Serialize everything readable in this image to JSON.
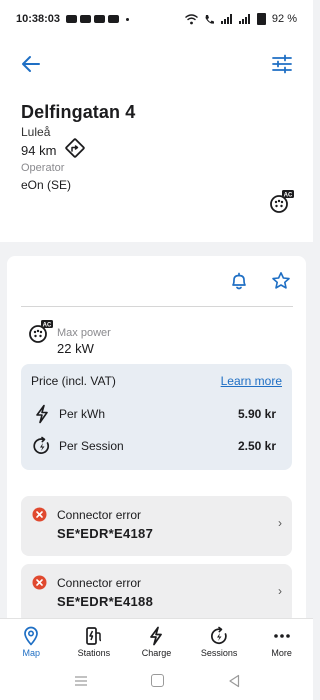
{
  "status_bar": {
    "time": "10:38:03",
    "battery": "92 %"
  },
  "icons": {
    "back": "arrow-left-icon",
    "filter": "sliders-icon",
    "route": "route-diamond-icon",
    "connector": "ac-type2-connector-icon",
    "bell": "bell-icon",
    "star": "star-icon",
    "lightning": "lightning-icon",
    "session": "session-timer-icon",
    "error": "error-x-icon"
  },
  "colors": {
    "accent": "#1f6fc4",
    "error": "#e0492f"
  },
  "station": {
    "name": "Delfingatan 4",
    "city": "Luleå",
    "distance": "94 km",
    "operator_label": "Operator",
    "operator": "eOn (SE)"
  },
  "power": {
    "label": "Max power",
    "value": "22 kW",
    "badge": "AC"
  },
  "price": {
    "title": "Price (incl. VAT)",
    "learn_more": "Learn more",
    "rows": [
      {
        "label": "Per kWh",
        "value": "5.90 kr"
      },
      {
        "label": "Per Session",
        "value": "2.50 kr"
      }
    ]
  },
  "connectors": [
    {
      "status": "Connector error",
      "id": "SE*EDR*E4187",
      "chevron": "›"
    },
    {
      "status": "Connector error",
      "id": "SE*EDR*E4188",
      "chevron": "›"
    }
  ],
  "nav": {
    "items": [
      {
        "label": "Map",
        "active": true
      },
      {
        "label": "Stations",
        "active": false
      },
      {
        "label": "Charge",
        "active": false
      },
      {
        "label": "Sessions",
        "active": false
      },
      {
        "label": "More",
        "active": false
      }
    ]
  }
}
